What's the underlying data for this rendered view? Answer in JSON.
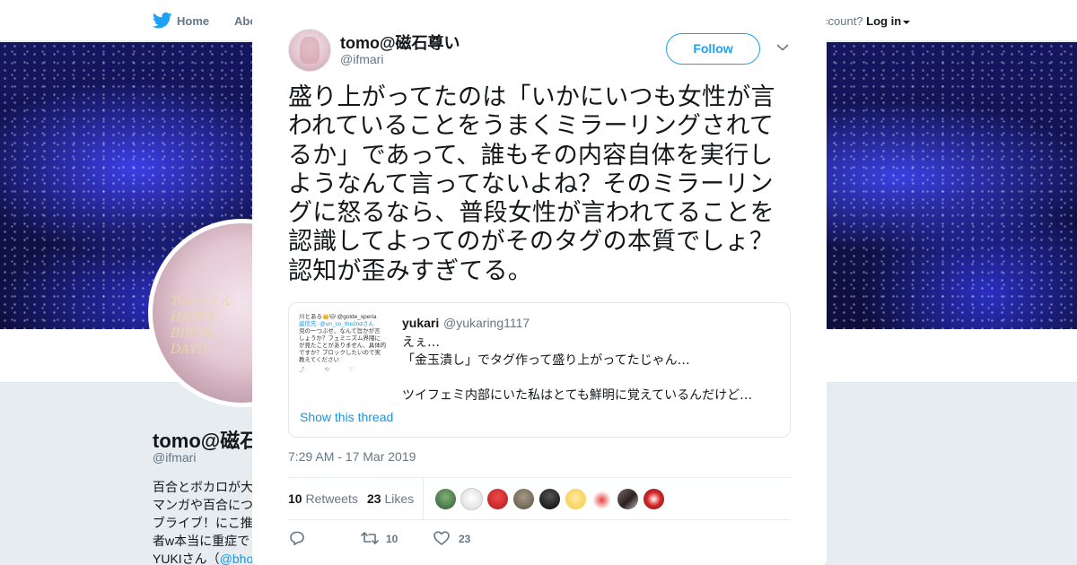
{
  "colors": {
    "accent": "#1da1f2",
    "link": "#1b95e0",
    "text": "#14171a",
    "muted": "#657786",
    "border": "#e6ecf0"
  },
  "topbar": {
    "logo_icon": "bird-icon",
    "nav": [
      {
        "label": "Home",
        "icon": "bird-icon"
      },
      {
        "label": "Abo"
      }
    ],
    "account_prompt": "ccount?",
    "login_label": "Log in"
  },
  "profile": {
    "name": "tomo@磁石尊",
    "handle": "@ifmari",
    "avatar_text": [
      "Tomo ∠ん",
      "HAPPY",
      "BIRTH",
      "DAY!!"
    ],
    "bio_lines": [
      "百合とボカロが大",
      "マンガや百合につ",
      "ブライブ！にこ推",
      "者w本当に重症で",
      "YUKIさん（@bho"
    ],
    "bio_link": "@bho"
  },
  "modal": {
    "close_icon": "close-icon"
  },
  "tweet": {
    "author": {
      "name": "tomo@磁石尊い",
      "handle": "@ifmari"
    },
    "follow_label": "Follow",
    "more_icon": "chevron-down-icon",
    "text": "盛り上がってたのは「いかにいつも女性が言われていることをうまくミラーリングされてるか」であって、誰もその内容自体を実行しようなんて言ってないよね？そのミラーリングに怒るなら、普段女性が言われてることを認識してよってのがそのタグの本質でしょ？認知が歪みすぎてる。",
    "quoted": {
      "name": "yukari",
      "handle": "@yukaring1117",
      "text_lines": [
        "えぇ…",
        "「金玉潰し」でタグ作って盛り上がってたじゃん…",
        "",
        "ツイフェミ内部にいた私はとても鮮明に覚えているんだけど…"
      ],
      "thumbnail_lines": [
        "川とある👑🐱 @golde_xperia",
        "返信先: @un_co_the2ndさん",
        "児の一つぶせ、なんて旨かが言",
        "しょうか？フェミニズム界隈に",
        "が見たことがありません、具体的",
        "ですか？ブロックしたいので実",
        "教えてください"
      ],
      "thumbnail_link_line": "返信先: @un_co_the2ndさん",
      "show_thread_label": "Show this thread"
    },
    "timestamp": "7:29 AM - 17 Mar 2019",
    "retweets": {
      "count": "10",
      "label": "Retweets"
    },
    "likes": {
      "count": "23",
      "label": "Likes"
    },
    "likers_count_shown": 9,
    "actions": {
      "reply_icon": "reply-icon",
      "retweet_icon": "retweet-icon",
      "retweet_count": "10",
      "like_icon": "heart-icon",
      "like_count": "23"
    }
  }
}
